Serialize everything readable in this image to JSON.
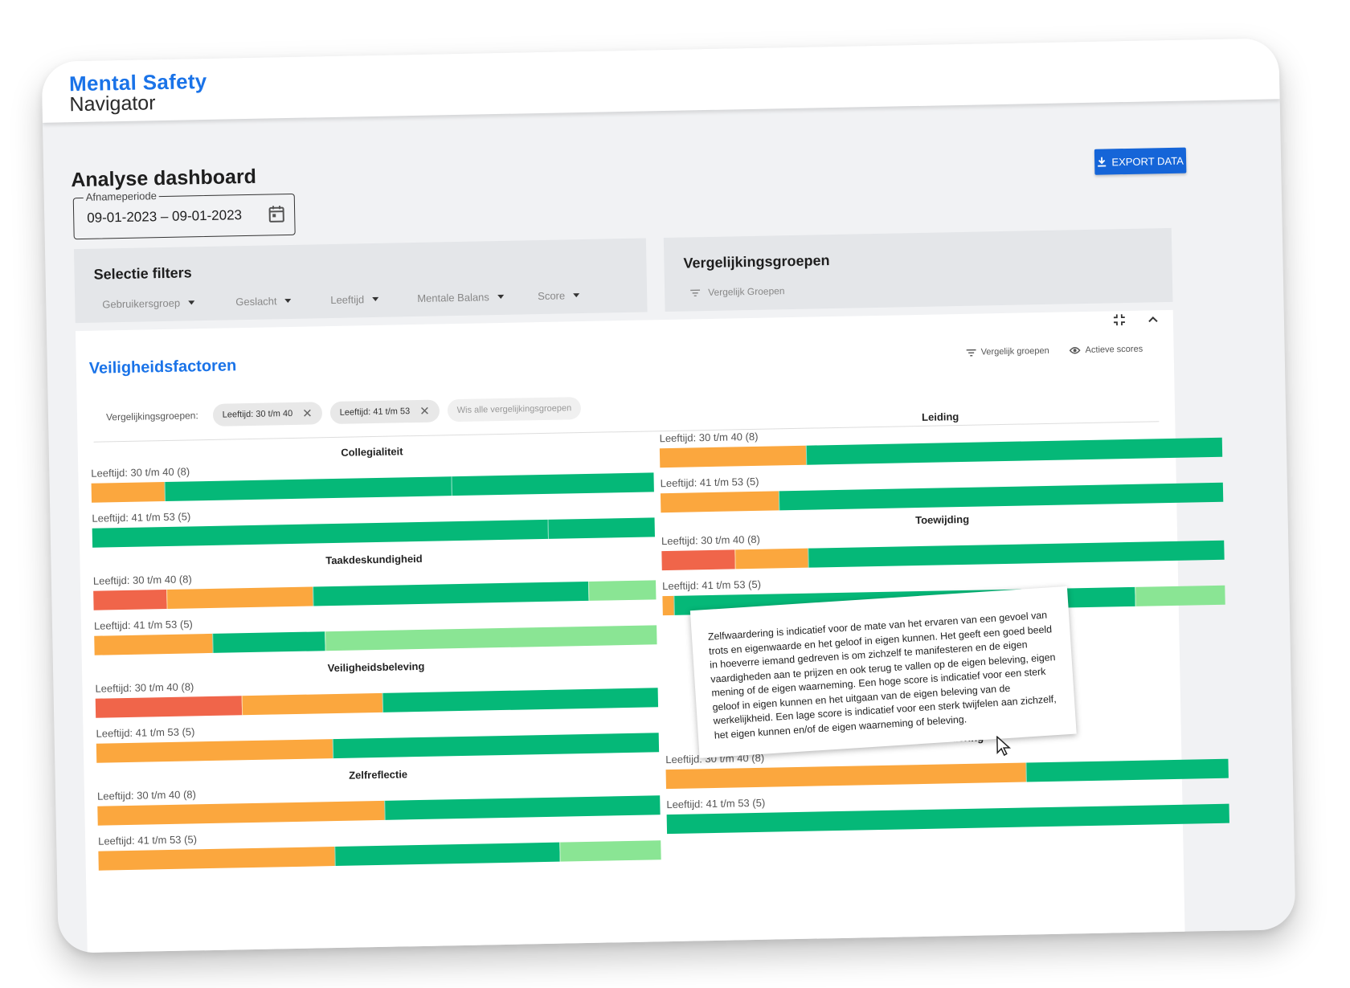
{
  "app": {
    "logo_line1": "Mental Safety",
    "logo_line2": "Navigator"
  },
  "header": {
    "title": "Analyse dashboard",
    "export_label": "EXPORT DATA",
    "export_icon": "download-icon"
  },
  "period": {
    "label": "Afnameperiode",
    "value": "09-01-2023 – 09-01-2023",
    "icon": "calendar-icon"
  },
  "filters": {
    "title": "Selectie filters",
    "items": [
      "Gebruikersgroep",
      "Geslacht",
      "Leeftijd",
      "Mentale Balans",
      "Score"
    ]
  },
  "comparison": {
    "title": "Vergelijkingsgroepen",
    "link": "Vergelijk Groepen",
    "icon": "filter-icon"
  },
  "card": {
    "title": "Veiligheidsfactoren",
    "compare_link": "Vergelijk groepen",
    "active_scores": "Actieve scores",
    "icons": [
      "fullscreen-exit-icon",
      "chevron-up-icon"
    ]
  },
  "chips": {
    "label": "Vergelijkingsgroepen:",
    "items": [
      "Leeftijd: 30 t/m 40",
      "Leeftijd: 41 t/m 53"
    ],
    "clear": "Wis alle vergelijkingsgroepen"
  },
  "colors": {
    "red": "#f0654a",
    "orange": "#fba73e",
    "green": "#05b878",
    "light_green": "#8ae594"
  },
  "chart_data": {
    "type": "bar",
    "stacked": true,
    "segment_order": [
      "red",
      "orange",
      "green",
      "light_green"
    ],
    "factors": [
      {
        "name": "Collegialiteit",
        "rows": [
          {
            "label": "Leeftijd: 30 t/m 40 (8)",
            "values": [
              0,
              13,
              51,
              36,
              0
            ]
          },
          {
            "label": "Leeftijd: 41 t/m 53 (5)",
            "values": [
              0,
              0,
              81,
              19,
              0
            ]
          }
        ]
      },
      {
        "name": "Leiding",
        "rows": [
          {
            "label": "Leeftijd: 30 t/m 40 (8)",
            "values": [
              0,
              26,
              74,
              0
            ]
          },
          {
            "label": "Leeftijd: 41 t/m 53 (5)",
            "values": [
              0,
              21,
              79,
              0
            ]
          }
        ]
      },
      {
        "name": "Taakdeskundigheid",
        "rows": [
          {
            "label": "Leeftijd: 30 t/m 40 (8)",
            "values": [
              13,
              26,
              49,
              12
            ]
          },
          {
            "label": "Leeftijd: 41 t/m 53 (5)",
            "values": [
              0,
              21,
              20,
              59
            ]
          }
        ]
      },
      {
        "name": "Toewijding",
        "rows": [
          {
            "label": "Leeftijd: 30 t/m 40 (8)",
            "values": [
              13,
              13,
              74,
              0
            ]
          },
          {
            "label": "Leeftijd: 41 t/m 53 (5)",
            "values": [
              0,
              2,
              82,
              16
            ]
          }
        ]
      },
      {
        "name": "Veiligheidsbeleving",
        "rows": [
          {
            "label": "Leeftijd: 30 t/m 40 (8)",
            "values": [
              26,
              25,
              49,
              0
            ]
          },
          {
            "label": "Leeftijd: 41 t/m 53 (5)",
            "values": [
              0,
              42,
              58,
              0
            ]
          }
        ]
      },
      {
        "name": "Zelfwaardering",
        "rows": [
          {
            "label": "Leeftijd: 30 t/m 40 (8)",
            "values": [
              0,
              64,
              36,
              0
            ]
          },
          {
            "label": "Leeftijd: 41 t/m 53 (5)",
            "values": [
              0,
              0,
              100,
              0
            ]
          }
        ]
      },
      {
        "name": "Zelfreflectie",
        "rows": [
          {
            "label": "Leeftijd: 30 t/m 40 (8)",
            "values": [
              0,
              51,
              49,
              0
            ]
          },
          {
            "label": "Leeftijd: 41 t/m 53 (5)",
            "values": [
              0,
              42,
              40,
              18
            ]
          }
        ]
      }
    ]
  },
  "tooltip": {
    "text": "Zelfwaardering is indicatief voor de mate van het ervaren van een gevoel van trots en eigenwaarde en het geloof in eigen kunnen. Het geeft een goed beeld in hoeverre iemand gedreven is om zichzelf te manifesteren en de eigen vaardigheden aan te prijzen en ook terug te vallen op de eigen beleving, eigen mening of de eigen waarneming. Een hoge score is indicatief voor een sterk geloof in eigen kunnen en het uitgaan van de eigen beleving van de werkelijkheid. Een lage score is indicatief voor een sterk twijfelen aan zichzelf, het eigen kunnen en/of de eigen waarneming of beleving."
  }
}
